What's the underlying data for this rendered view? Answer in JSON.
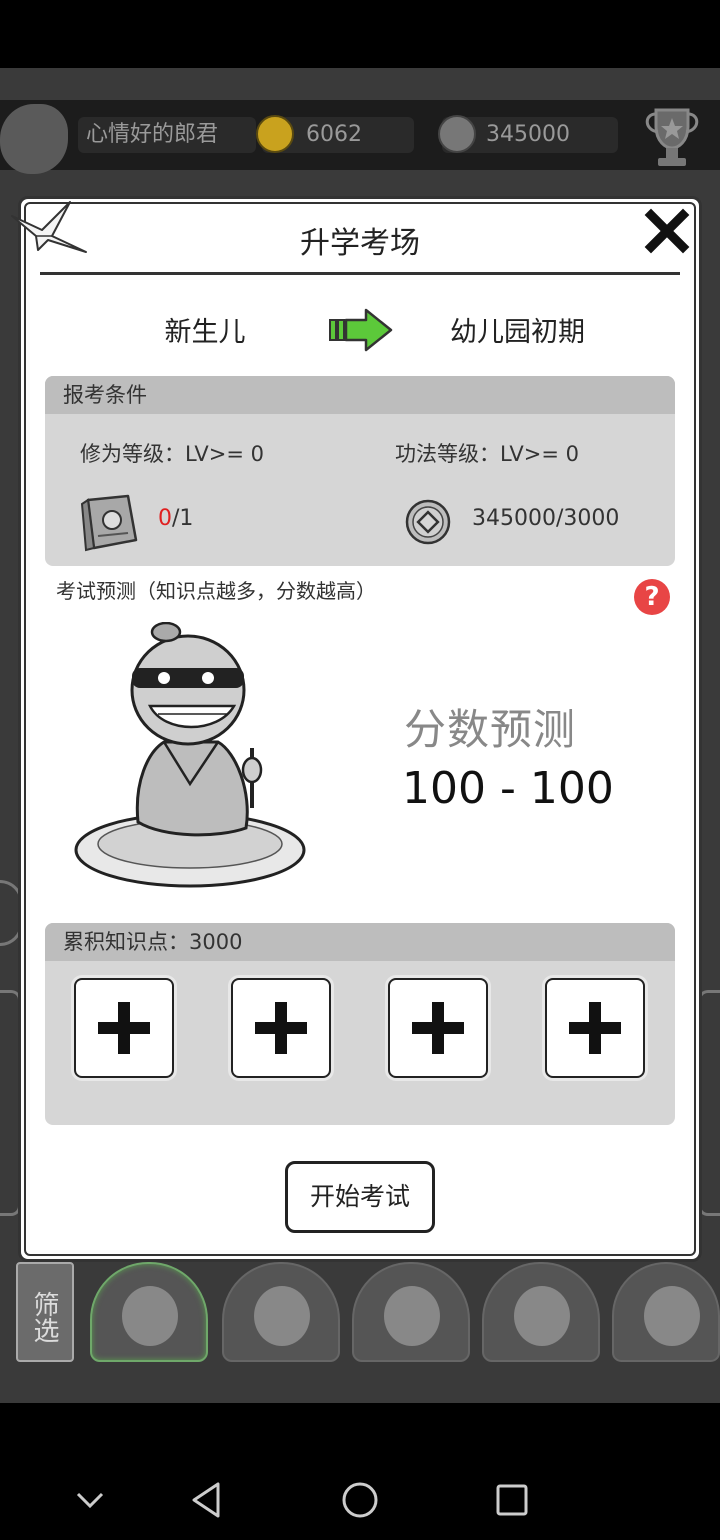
{
  "header": {
    "player_name": "心情好的郎君",
    "gold": "6062",
    "silver": "345000"
  },
  "dialog": {
    "title": "升学考场",
    "from_stage": "新生儿",
    "to_stage": "幼儿园初期",
    "requirements": {
      "heading": "报考条件",
      "cultivation_level": "修为等级：LV>= 0",
      "skill_level": "功法等级：LV>= 0",
      "book_have": "0",
      "book_need": "/1",
      "coins": "345000/3000"
    },
    "prediction": {
      "label": "考试预测（知识点越多，分数越高）",
      "help": "?",
      "score_title": "分数预测",
      "score_range": "100 - 100"
    },
    "knowledge": {
      "heading": "累积知识点：3000",
      "slots": [
        "+",
        "+",
        "+",
        "+"
      ]
    },
    "start_button": "开始考试"
  },
  "strip": {
    "filter_button": "筛选"
  },
  "colors": {
    "accent_green": "#5cc93a",
    "warning_red": "#e02020",
    "help_red": "#e84545"
  }
}
